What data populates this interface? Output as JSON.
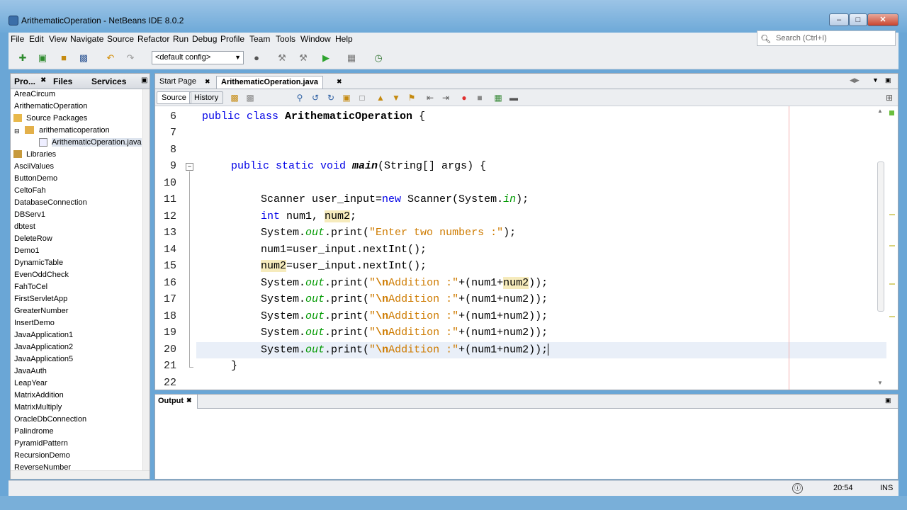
{
  "window": {
    "title": "ArithematicOperation - NetBeans IDE 8.0.2",
    "controls": {
      "minimize": "–",
      "maximize": "□",
      "close": "✕"
    }
  },
  "menu": [
    "File",
    "Edit",
    "View",
    "Navigate",
    "Source",
    "Refactor",
    "Run",
    "Debug",
    "Profile",
    "Team",
    "Tools",
    "Window",
    "Help"
  ],
  "search": {
    "placeholder": "Search (Ctrl+I)"
  },
  "toolbar": {
    "config": "<default config>"
  },
  "left_panel": {
    "tabs": [
      "Pro...",
      "Files",
      "Services"
    ],
    "tree": [
      {
        "label": "AreaCircum",
        "depth": 0
      },
      {
        "label": "ArithematicOperation",
        "depth": 0
      },
      {
        "label": "Source Packages",
        "depth": 1
      },
      {
        "label": "arithematicoperation",
        "depth": 2
      },
      {
        "label": "ArithematicOperation.java",
        "depth": 3
      },
      {
        "label": "Libraries",
        "depth": 1
      },
      {
        "label": "AsciiValues",
        "depth": 0
      },
      {
        "label": "ButtonDemo",
        "depth": 0
      },
      {
        "label": "CeltoFah",
        "depth": 0
      },
      {
        "label": "DatabaseConnection",
        "depth": 0
      },
      {
        "label": "DBServ1",
        "depth": 0
      },
      {
        "label": "dbtest",
        "depth": 0
      },
      {
        "label": "DeleteRow",
        "depth": 0
      },
      {
        "label": "Demo1",
        "depth": 0
      },
      {
        "label": "DynamicTable",
        "depth": 0
      },
      {
        "label": "EvenOddCheck",
        "depth": 0
      },
      {
        "label": "FahToCel",
        "depth": 0
      },
      {
        "label": "FirstServletApp",
        "depth": 0
      },
      {
        "label": "GreaterNumber",
        "depth": 0
      },
      {
        "label": "InsertDemo",
        "depth": 0
      },
      {
        "label": "JavaApplication1",
        "depth": 0
      },
      {
        "label": "JavaApplication2",
        "depth": 0
      },
      {
        "label": "JavaApplication5",
        "depth": 0
      },
      {
        "label": "JavaAuth",
        "depth": 0
      },
      {
        "label": "LeapYear",
        "depth": 0
      },
      {
        "label": "MatrixAddition",
        "depth": 0
      },
      {
        "label": "MatrixMultiply",
        "depth": 0
      },
      {
        "label": "OracleDbConnection",
        "depth": 0
      },
      {
        "label": "Palindrome",
        "depth": 0
      },
      {
        "label": "PyramidPattern",
        "depth": 0
      },
      {
        "label": "RecursionDemo",
        "depth": 0
      },
      {
        "label": "ReverseNumber",
        "depth": 0
      }
    ]
  },
  "editor": {
    "tabs": [
      "Start Page",
      "ArithematicOperation.java"
    ],
    "view_tabs": [
      "Source",
      "History"
    ],
    "line_numbers": [
      "6",
      "7",
      "8",
      "9",
      "10",
      "11",
      "12",
      "13",
      "14",
      "15",
      "16",
      "17",
      "18",
      "19",
      "20",
      "21",
      "22"
    ],
    "code": {
      "l6_kw": "public class ",
      "l6_cls": "ArithematicOperation",
      "l6_end": " {",
      "l9_kw": "public static void ",
      "l9_m": "main",
      "l9_end": "(String[] args) {",
      "l11_a": "Scanner user_input=",
      "l11_kw": "new",
      "l11_b": " Scanner(System.",
      "l11_f": "in",
      "l11_c": ");",
      "l12_kw": "int",
      "l12_a": " num1, ",
      "l12_hl": "num2",
      "l12_b": ";",
      "sys": "System.",
      "out": "out",
      "print": ".print(",
      "l13_str": "\"Enter two numbers :\"",
      "l13_end": ");",
      "l14": "num1=user_input.nextInt();",
      "l15_hl": "num2",
      "l15_rest": "=user_input.nextInt();",
      "q": "\"",
      "esc": "\\n",
      "add_str": "Addition :\"",
      "plus_open": "+(num1+",
      "num2": "num2",
      "close": "));",
      "l21": "}"
    }
  },
  "output": {
    "tab": "Output"
  },
  "status": {
    "position": "20:54",
    "mode": "INS"
  }
}
